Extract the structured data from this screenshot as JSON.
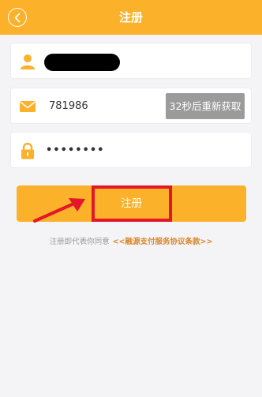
{
  "header": {
    "title": "注册",
    "back_icon": "chevron-left-icon"
  },
  "form": {
    "username": {
      "icon": "user-icon",
      "value_redacted": true
    },
    "verify_code": {
      "icon": "mail-icon",
      "value": "781986",
      "resend_label": "32秒后重新获取"
    },
    "password": {
      "icon": "lock-icon",
      "value": "••••••••"
    }
  },
  "register_button": {
    "label": "注册"
  },
  "agreement": {
    "prefix": "注册即代表你同意",
    "link": "<<融源支付服务协议条款>>"
  },
  "colors": {
    "accent": "#fbb12a",
    "highlight": "#e4162a",
    "link": "#d9862b"
  }
}
